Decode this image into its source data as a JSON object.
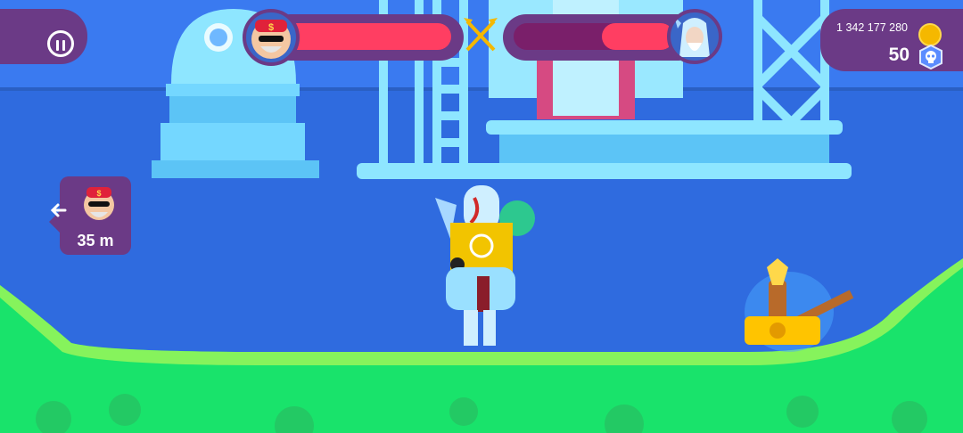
{
  "hud": {
    "pause_icon": "pause-icon",
    "player_avatar_icon": "rapper-avatar-icon",
    "player_health": 1.0,
    "player_health_color": "#ff3e62",
    "versus_icon": "crossed-arrows-icon",
    "enemy_avatar_icon": "wizard-avatar-icon",
    "enemy_health_remaining": 0.45,
    "enemy_health_color": "#ff3e62",
    "enemy_health_empty_color": "#7a1f6a",
    "coins": "1 342 177 280",
    "coin_icon": "coin-icon",
    "skulls": "50",
    "skull_icon": "skull-icon"
  },
  "offscreen_indicator": {
    "avatar_icon": "rapper-avatar-icon",
    "arrow_icon": "arrow-left-icon",
    "distance": "35 m"
  },
  "colors": {
    "sky": "#2f6bdf",
    "panel": "#6b3a86",
    "ground": "#19e36b",
    "ground_light": "#86f35c",
    "scenery": "#74d7ff"
  }
}
